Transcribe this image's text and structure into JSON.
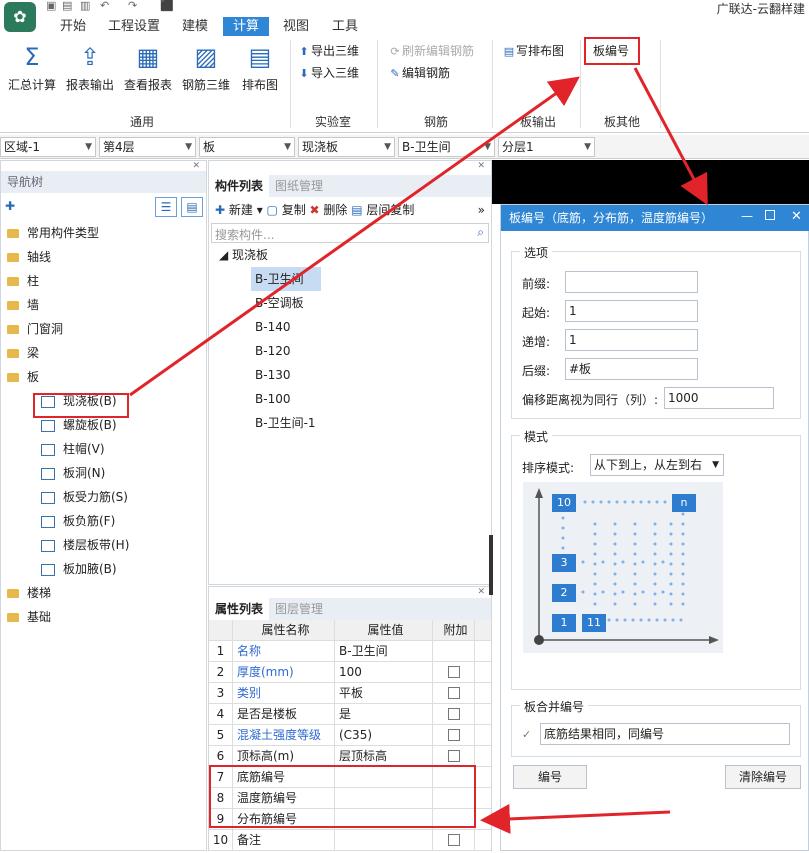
{
  "app": {
    "title": "广联达-云翻样建"
  },
  "ribbon": {
    "tabs": [
      "开始",
      "工程设置",
      "建模",
      "计算",
      "视图",
      "工具"
    ],
    "active_tab": "计算",
    "buttons": [
      {
        "label": "汇总计算",
        "icon": "sigma-icon"
      },
      {
        "label": "报表输出",
        "icon": "report-export-icon"
      },
      {
        "label": "查看报表",
        "icon": "report-view-icon"
      },
      {
        "label": "钢筋三维",
        "icon": "rebar-3d-icon"
      },
      {
        "label": "排布图",
        "icon": "layout-icon"
      }
    ],
    "lab_buttons": [
      "导出三维",
      "导入三维"
    ],
    "rebar_buttons": [
      "刷新编辑钢筋",
      "编辑钢筋"
    ],
    "output_buttons": [
      "写排布图"
    ],
    "other_buttons": [
      "板编号"
    ],
    "groups": [
      "通用",
      "实验室",
      "钢筋",
      "板输出",
      "板其他"
    ]
  },
  "filters": [
    "区域-1",
    "第4层",
    "板",
    "现浇板",
    "B-卫生间",
    "分层1"
  ],
  "nav": {
    "title": "导航树",
    "items": [
      {
        "label": "常用构件类型",
        "type": "folder"
      },
      {
        "label": "轴线",
        "type": "folder"
      },
      {
        "label": "柱",
        "type": "folder"
      },
      {
        "label": "墙",
        "type": "folder"
      },
      {
        "label": "门窗洞",
        "type": "folder"
      },
      {
        "label": "梁",
        "type": "folder"
      },
      {
        "label": "板",
        "type": "folder"
      },
      {
        "label": "现浇板(B)",
        "type": "sub"
      },
      {
        "label": "螺旋板(B)",
        "type": "sub"
      },
      {
        "label": "柱帽(V)",
        "type": "sub"
      },
      {
        "label": "板洞(N)",
        "type": "sub"
      },
      {
        "label": "板受力筋(S)",
        "type": "sub"
      },
      {
        "label": "板负筋(F)",
        "type": "sub"
      },
      {
        "label": "楼层板带(H)",
        "type": "sub"
      },
      {
        "label": "板加腋(B)",
        "type": "sub"
      },
      {
        "label": "楼梯",
        "type": "folder"
      },
      {
        "label": "基础",
        "type": "folder"
      }
    ]
  },
  "component_list": {
    "tabs": [
      "构件列表",
      "图纸管理"
    ],
    "toolbar": [
      "新建",
      "复制",
      "删除",
      "层间复制"
    ],
    "search_placeholder": "搜索构件...",
    "root": "现浇板",
    "items": [
      "B-卫生间",
      "B-空调板",
      "B-140",
      "B-120",
      "B-130",
      "B-100",
      "B-卫生间-1"
    ]
  },
  "props": {
    "tabs": [
      "属性列表",
      "图层管理"
    ],
    "headers": [
      "属性名称",
      "属性值",
      "附加"
    ],
    "rows": [
      {
        "n": "1",
        "name": "名称",
        "value": "B-卫生间",
        "blue": true,
        "chk": false
      },
      {
        "n": "2",
        "name": "厚度(mm)",
        "value": "100",
        "blue": true,
        "chk": true
      },
      {
        "n": "3",
        "name": "类别",
        "value": "平板",
        "blue": true,
        "chk": true
      },
      {
        "n": "4",
        "name": "是否是楼板",
        "value": "是",
        "blue": false,
        "chk": true
      },
      {
        "n": "5",
        "name": "混凝土强度等级",
        "value": "(C35)",
        "blue": true,
        "chk": true
      },
      {
        "n": "6",
        "name": "顶标高(m)",
        "value": "层顶标高",
        "blue": false,
        "chk": true
      },
      {
        "n": "7",
        "name": "底筋编号",
        "value": "",
        "blue": false,
        "chk": false
      },
      {
        "n": "8",
        "name": "温度筋编号",
        "value": "",
        "blue": false,
        "chk": false
      },
      {
        "n": "9",
        "name": "分布筋编号",
        "value": "",
        "blue": false,
        "chk": false
      },
      {
        "n": "10",
        "name": "备注",
        "value": "",
        "blue": false,
        "chk": true
      }
    ]
  },
  "dialog": {
    "title": "板编号（底筋，分布筋，温度筋编号）",
    "options_legend": "选项",
    "prefix_label": "前缀:",
    "prefix_value": "",
    "start_label": "起始:",
    "start_value": "1",
    "step_label": "递增:",
    "step_value": "1",
    "suffix_label": "后缀:",
    "suffix_value": "#板",
    "offset_label": "偏移距离视为同行（列）:",
    "offset_value": "1000",
    "mode_legend": "模式",
    "sort_label": "排序模式:",
    "sort_value": "从下到上，从左到右",
    "diagram_labels": [
      "10",
      "n",
      "3",
      "2",
      "1",
      "11"
    ],
    "merge_legend": "板合并编号",
    "merge_checkbox": "底筋结果相同，同编号",
    "btn_number": "编号",
    "btn_clear": "清除编号"
  }
}
